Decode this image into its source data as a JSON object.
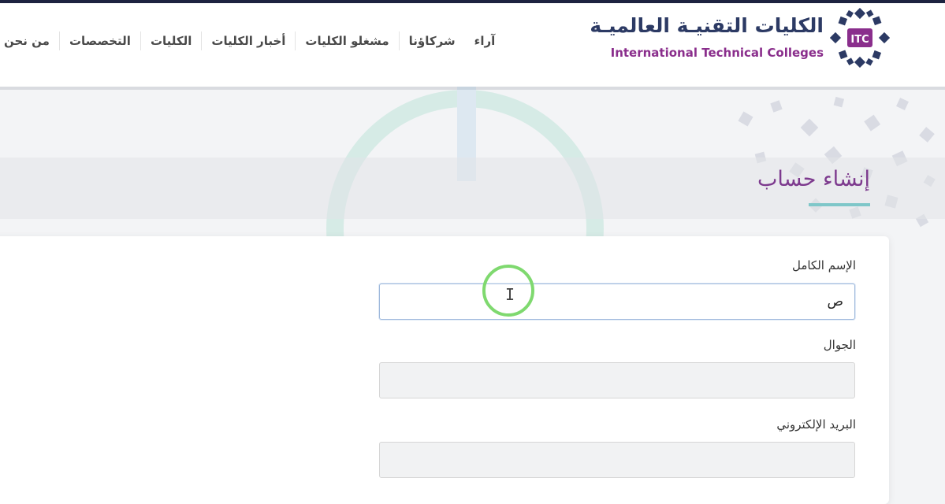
{
  "brand": {
    "arabic_name": "الكليات التقنيـة العالميـة",
    "english_name": "International Technical Colleges",
    "mark_text": "ITC"
  },
  "nav": {
    "items": [
      {
        "label": "من نحن"
      },
      {
        "label": "التخصصات"
      },
      {
        "label": "الكليات"
      },
      {
        "label": "أخبار الكليات"
      },
      {
        "label": "مشغلو الكليات"
      },
      {
        "label": "شركاؤنا"
      },
      {
        "label": "آراء"
      }
    ]
  },
  "page": {
    "title": "إنشاء حساب"
  },
  "form": {
    "fields": [
      {
        "label": "الإسم الكامل",
        "value": "ص",
        "active": true
      },
      {
        "label": "الجوال",
        "value": ""
      },
      {
        "label": "البريد الإلكتروني",
        "value": ""
      }
    ]
  },
  "colors": {
    "brand_navy": "#2c3a64",
    "brand_purple": "#8a2e8c",
    "title_purple": "#7d3a8e",
    "accent_teal": "#7fc7c9",
    "cursor_ring": "#7fd96f"
  },
  "icons": {
    "logo": "itc-star-logo-icon",
    "cursor": "text-cursor-icon"
  }
}
